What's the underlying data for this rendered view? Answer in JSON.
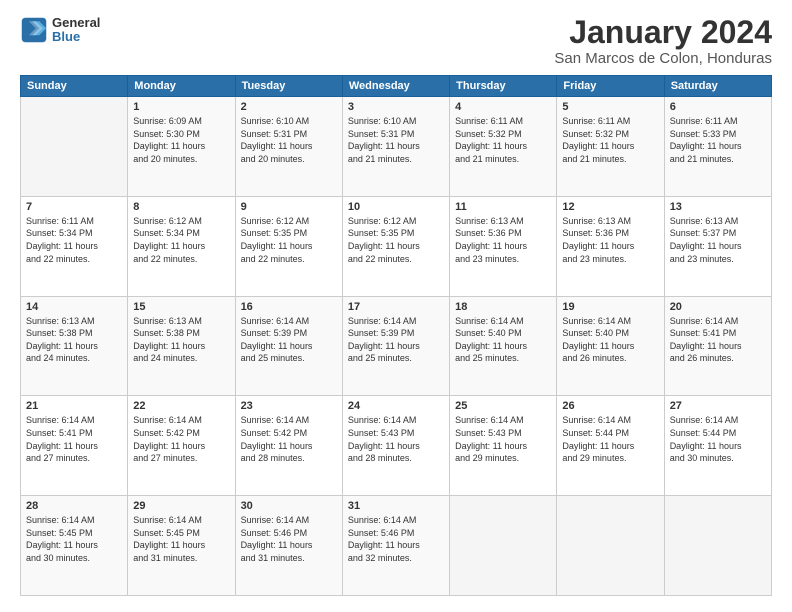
{
  "header": {
    "logo_line1": "General",
    "logo_line2": "Blue",
    "month": "January 2024",
    "location": "San Marcos de Colon, Honduras"
  },
  "weekdays": [
    "Sunday",
    "Monday",
    "Tuesday",
    "Wednesday",
    "Thursday",
    "Friday",
    "Saturday"
  ],
  "weeks": [
    [
      {
        "day": "",
        "info": ""
      },
      {
        "day": "1",
        "info": "Sunrise: 6:09 AM\nSunset: 5:30 PM\nDaylight: 11 hours\nand 20 minutes."
      },
      {
        "day": "2",
        "info": "Sunrise: 6:10 AM\nSunset: 5:31 PM\nDaylight: 11 hours\nand 20 minutes."
      },
      {
        "day": "3",
        "info": "Sunrise: 6:10 AM\nSunset: 5:31 PM\nDaylight: 11 hours\nand 21 minutes."
      },
      {
        "day": "4",
        "info": "Sunrise: 6:11 AM\nSunset: 5:32 PM\nDaylight: 11 hours\nand 21 minutes."
      },
      {
        "day": "5",
        "info": "Sunrise: 6:11 AM\nSunset: 5:32 PM\nDaylight: 11 hours\nand 21 minutes."
      },
      {
        "day": "6",
        "info": "Sunrise: 6:11 AM\nSunset: 5:33 PM\nDaylight: 11 hours\nand 21 minutes."
      }
    ],
    [
      {
        "day": "7",
        "info": "Sunrise: 6:11 AM\nSunset: 5:34 PM\nDaylight: 11 hours\nand 22 minutes."
      },
      {
        "day": "8",
        "info": "Sunrise: 6:12 AM\nSunset: 5:34 PM\nDaylight: 11 hours\nand 22 minutes."
      },
      {
        "day": "9",
        "info": "Sunrise: 6:12 AM\nSunset: 5:35 PM\nDaylight: 11 hours\nand 22 minutes."
      },
      {
        "day": "10",
        "info": "Sunrise: 6:12 AM\nSunset: 5:35 PM\nDaylight: 11 hours\nand 22 minutes."
      },
      {
        "day": "11",
        "info": "Sunrise: 6:13 AM\nSunset: 5:36 PM\nDaylight: 11 hours\nand 23 minutes."
      },
      {
        "day": "12",
        "info": "Sunrise: 6:13 AM\nSunset: 5:36 PM\nDaylight: 11 hours\nand 23 minutes."
      },
      {
        "day": "13",
        "info": "Sunrise: 6:13 AM\nSunset: 5:37 PM\nDaylight: 11 hours\nand 23 minutes."
      }
    ],
    [
      {
        "day": "14",
        "info": "Sunrise: 6:13 AM\nSunset: 5:38 PM\nDaylight: 11 hours\nand 24 minutes."
      },
      {
        "day": "15",
        "info": "Sunrise: 6:13 AM\nSunset: 5:38 PM\nDaylight: 11 hours\nand 24 minutes."
      },
      {
        "day": "16",
        "info": "Sunrise: 6:14 AM\nSunset: 5:39 PM\nDaylight: 11 hours\nand 25 minutes."
      },
      {
        "day": "17",
        "info": "Sunrise: 6:14 AM\nSunset: 5:39 PM\nDaylight: 11 hours\nand 25 minutes."
      },
      {
        "day": "18",
        "info": "Sunrise: 6:14 AM\nSunset: 5:40 PM\nDaylight: 11 hours\nand 25 minutes."
      },
      {
        "day": "19",
        "info": "Sunrise: 6:14 AM\nSunset: 5:40 PM\nDaylight: 11 hours\nand 26 minutes."
      },
      {
        "day": "20",
        "info": "Sunrise: 6:14 AM\nSunset: 5:41 PM\nDaylight: 11 hours\nand 26 minutes."
      }
    ],
    [
      {
        "day": "21",
        "info": "Sunrise: 6:14 AM\nSunset: 5:41 PM\nDaylight: 11 hours\nand 27 minutes."
      },
      {
        "day": "22",
        "info": "Sunrise: 6:14 AM\nSunset: 5:42 PM\nDaylight: 11 hours\nand 27 minutes."
      },
      {
        "day": "23",
        "info": "Sunrise: 6:14 AM\nSunset: 5:42 PM\nDaylight: 11 hours\nand 28 minutes."
      },
      {
        "day": "24",
        "info": "Sunrise: 6:14 AM\nSunset: 5:43 PM\nDaylight: 11 hours\nand 28 minutes."
      },
      {
        "day": "25",
        "info": "Sunrise: 6:14 AM\nSunset: 5:43 PM\nDaylight: 11 hours\nand 29 minutes."
      },
      {
        "day": "26",
        "info": "Sunrise: 6:14 AM\nSunset: 5:44 PM\nDaylight: 11 hours\nand 29 minutes."
      },
      {
        "day": "27",
        "info": "Sunrise: 6:14 AM\nSunset: 5:44 PM\nDaylight: 11 hours\nand 30 minutes."
      }
    ],
    [
      {
        "day": "28",
        "info": "Sunrise: 6:14 AM\nSunset: 5:45 PM\nDaylight: 11 hours\nand 30 minutes."
      },
      {
        "day": "29",
        "info": "Sunrise: 6:14 AM\nSunset: 5:45 PM\nDaylight: 11 hours\nand 31 minutes."
      },
      {
        "day": "30",
        "info": "Sunrise: 6:14 AM\nSunset: 5:46 PM\nDaylight: 11 hours\nand 31 minutes."
      },
      {
        "day": "31",
        "info": "Sunrise: 6:14 AM\nSunset: 5:46 PM\nDaylight: 11 hours\nand 32 minutes."
      },
      {
        "day": "",
        "info": ""
      },
      {
        "day": "",
        "info": ""
      },
      {
        "day": "",
        "info": ""
      }
    ]
  ]
}
